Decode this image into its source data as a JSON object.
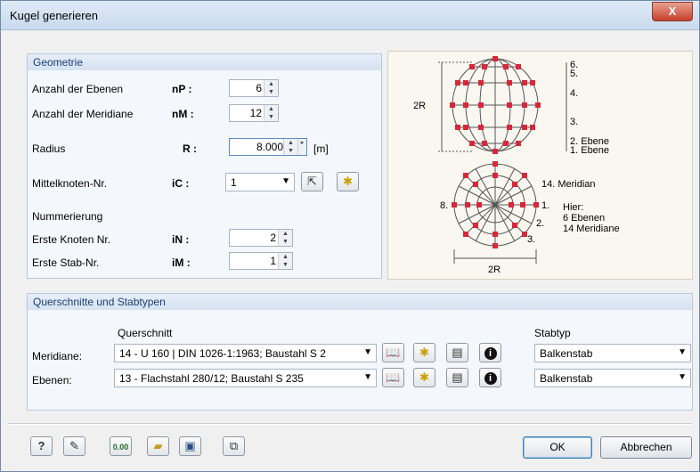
{
  "window": {
    "title": "Kugel generieren",
    "close_label": "X"
  },
  "geometry": {
    "header": "Geometrie",
    "rows": {
      "planes": {
        "label": "Anzahl der Ebenen",
        "symbol": "nP :",
        "value": "6"
      },
      "meridians": {
        "label": "Anzahl der Meridiane",
        "symbol": "nM :",
        "value": "12"
      },
      "radius": {
        "label": "Radius",
        "symbol": "R :",
        "value": "8.000",
        "unit": "[m]"
      },
      "center": {
        "label": "Mittelknoten-Nr.",
        "symbol": "iC :",
        "value": "1"
      },
      "numbering": {
        "label": "Nummerierung"
      },
      "first_node": {
        "label": "Erste Knoten Nr.",
        "symbol": "iN :",
        "value": "2"
      },
      "first_member": {
        "label": "Erste Stab-Nr.",
        "symbol": "iM :",
        "value": "1"
      }
    }
  },
  "diagram": {
    "height_label": "2R",
    "width_label": "2R",
    "levels": [
      "6.",
      "5.",
      "4.",
      "3.",
      "2. Ebene",
      "1. Ebene"
    ],
    "meridian_label": "14. Meridian",
    "meridian_1": "1.",
    "meridian_2": "2.",
    "meridian_3": "3.",
    "meridian_8": "8.",
    "note_title": "Hier:",
    "note_planes": "6 Ebenen",
    "note_meridians": "14 Meridiane"
  },
  "sections": {
    "header": "Querschnitte und Stabtypen",
    "cs_header": "Querschnitt",
    "type_header": "Stabtyp",
    "rows": [
      {
        "label": "Meridiane:",
        "cross_section": "14 - U 160 | DIN 1026-1:1963; Baustahl S 2",
        "member_type": "Balkenstab"
      },
      {
        "label": "Ebenen:",
        "cross_section": "13 - Flachstahl 280/12; Baustahl S 235",
        "member_type": "Balkenstab"
      }
    ]
  },
  "footer": {
    "ok": "OK",
    "cancel": "Abbrechen",
    "zero_label": "0.00"
  },
  "icons": [
    "help-icon",
    "edit-icon",
    "units-icon",
    "open-icon",
    "save-icon",
    "copy-icon",
    "library-icon",
    "new-icon",
    "pick-icon",
    "info-icon"
  ]
}
